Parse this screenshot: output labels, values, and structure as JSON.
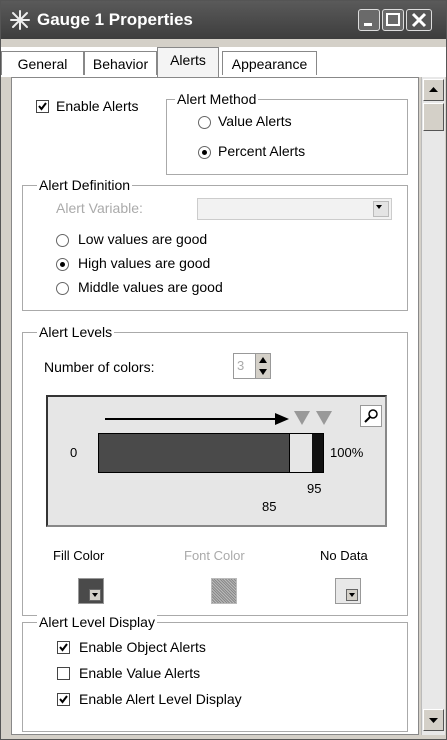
{
  "window": {
    "title": "Gauge 1 Properties"
  },
  "tabs": [
    {
      "label": "General"
    },
    {
      "label": "Behavior"
    },
    {
      "label": "Alerts"
    },
    {
      "label": "Appearance"
    }
  ],
  "alerts": {
    "enable_alerts_label": "Enable Alerts",
    "enable_alerts_checked": true,
    "alert_method": {
      "legend": "Alert Method",
      "options": [
        {
          "label": "Value Alerts",
          "selected": false
        },
        {
          "label": "Percent Alerts",
          "selected": true
        }
      ]
    },
    "alert_definition": {
      "legend": "Alert Definition",
      "variable_label": "Alert Variable:",
      "variable_value": "",
      "options": [
        {
          "label": "Low values are good",
          "selected": false
        },
        {
          "label": "High values are good",
          "selected": true
        },
        {
          "label": "Middle values are good",
          "selected": false
        }
      ]
    },
    "alert_levels": {
      "legend": "Alert Levels",
      "num_colors_label": "Number of colors:",
      "num_colors_value": "3",
      "bar_min_label": "0",
      "bar_max_label": "100%",
      "threshold_1": "85",
      "threshold_2": "95",
      "fill_color_label": "Fill Color",
      "font_color_label": "Font Color",
      "no_data_label": "No Data",
      "colors": {
        "fill": "#4a4a4a",
        "mid": "#e6e6e6",
        "high": "#111111"
      }
    },
    "alert_level_display": {
      "legend": "Alert Level Display",
      "items": [
        {
          "label": "Enable Object Alerts",
          "checked": true
        },
        {
          "label": "Enable Value Alerts",
          "checked": false
        },
        {
          "label": "Enable Alert Level Display",
          "checked": true
        }
      ]
    }
  }
}
